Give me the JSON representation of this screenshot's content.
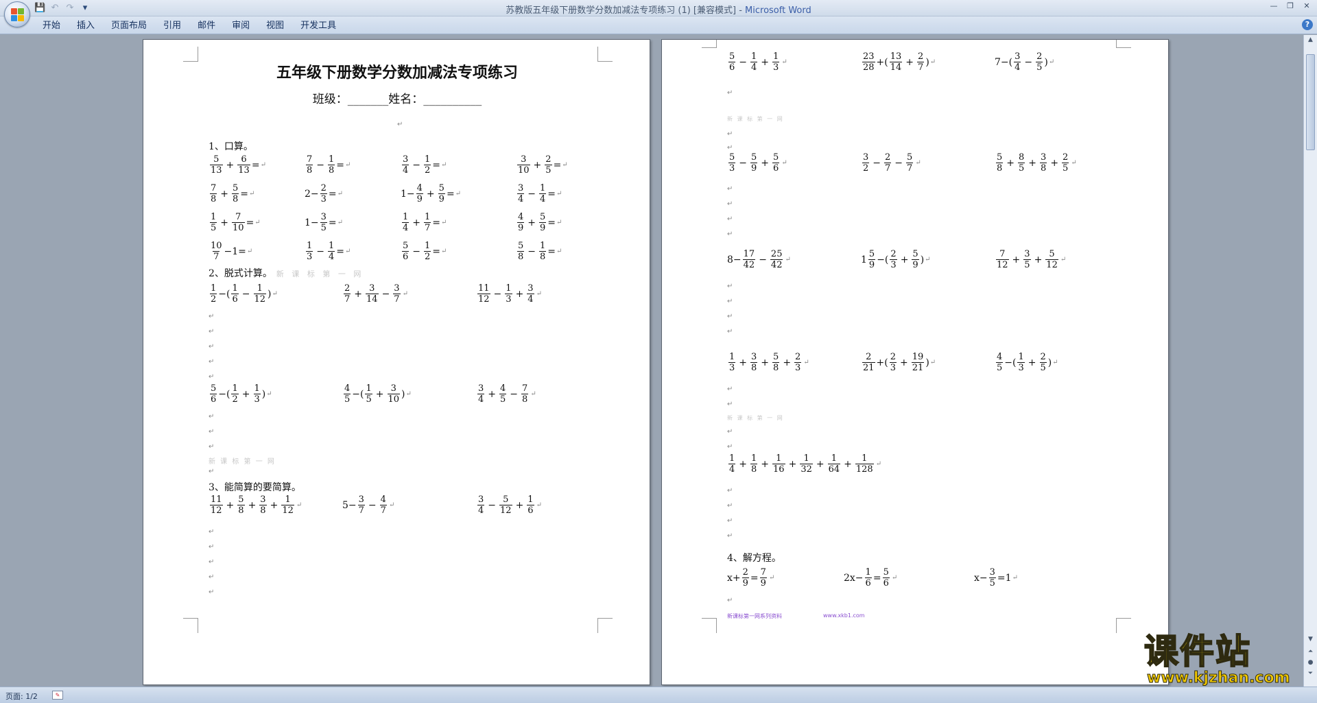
{
  "window": {
    "title": "苏教版五年级下册数学分数加减法专项练习 (1) [兼容模式] - ",
    "app_name": "Microsoft Word",
    "qat": [
      {
        "name": "save-icon",
        "glyph": "💾"
      },
      {
        "name": "undo-icon",
        "glyph": "↶"
      },
      {
        "name": "redo-icon",
        "glyph": "↷"
      },
      {
        "name": "customize-icon",
        "glyph": "▾"
      }
    ],
    "controls": [
      "—",
      "❐",
      "✕"
    ]
  },
  "ribbon": {
    "tabs": [
      "开始",
      "插入",
      "页面布局",
      "引用",
      "邮件",
      "审阅",
      "视图",
      "开发工具"
    ],
    "help_glyph": "?"
  },
  "page1": {
    "title": "五年级下册数学分数加减法专项练习",
    "subtitle": "班级：_______姓名：__________",
    "h1": "1、口算。",
    "h2": "2、脱式计算。",
    "h2_faint": "新 课 标 第 一 网",
    "faint_mid": "新 课 标 第 一 网",
    "h3": "3、能简算的要简算。",
    "oral": [
      [
        [
          {
            "f": [
              "5",
              "13"
            ]
          },
          {
            "o": "+"
          },
          {
            "f": [
              "6",
              "13"
            ]
          },
          {
            "t": "="
          }
        ],
        [
          {
            "f": [
              "7",
              "8"
            ]
          },
          {
            "o": "−"
          },
          {
            "f": [
              "1",
              "8"
            ]
          },
          {
            "t": "="
          }
        ],
        [
          {
            "f": [
              "3",
              "4"
            ]
          },
          {
            "o": "−"
          },
          {
            "f": [
              "1",
              "2"
            ]
          },
          {
            "t": "="
          }
        ],
        [
          {
            "f": [
              "3",
              "10"
            ]
          },
          {
            "o": "+"
          },
          {
            "f": [
              "2",
              "5"
            ]
          },
          {
            "t": "="
          }
        ]
      ],
      [
        [
          {
            "f": [
              "7",
              "8"
            ]
          },
          {
            "o": "+"
          },
          {
            "f": [
              "5",
              "8"
            ]
          },
          {
            "t": "="
          }
        ],
        [
          {
            "t": "2−"
          },
          {
            "f": [
              "2",
              "3"
            ]
          },
          {
            "t": "="
          }
        ],
        [
          {
            "t": "1−"
          },
          {
            "f": [
              "4",
              "9"
            ]
          },
          {
            "o": "+"
          },
          {
            "f": [
              "5",
              "9"
            ]
          },
          {
            "t": "="
          }
        ],
        [
          {
            "f": [
              "3",
              "4"
            ]
          },
          {
            "o": "−"
          },
          {
            "f": [
              "1",
              "4"
            ]
          },
          {
            "t": "="
          }
        ]
      ],
      [
        [
          {
            "f": [
              "1",
              "5"
            ]
          },
          {
            "o": "+"
          },
          {
            "f": [
              "7",
              "10"
            ]
          },
          {
            "t": "="
          }
        ],
        [
          {
            "t": "1−"
          },
          {
            "f": [
              "3",
              "5"
            ]
          },
          {
            "t": "="
          }
        ],
        [
          {
            "f": [
              "1",
              "4"
            ]
          },
          {
            "o": "+"
          },
          {
            "f": [
              "1",
              "7"
            ]
          },
          {
            "t": "="
          }
        ],
        [
          {
            "f": [
              "4",
              "9"
            ]
          },
          {
            "o": "+"
          },
          {
            "f": [
              "5",
              "9"
            ]
          },
          {
            "t": "="
          }
        ]
      ],
      [
        [
          {
            "f": [
              "10",
              "7"
            ]
          },
          {
            "t": "−1="
          }
        ],
        [
          {
            "f": [
              "1",
              "3"
            ]
          },
          {
            "o": "−"
          },
          {
            "f": [
              "1",
              "4"
            ]
          },
          {
            "t": "="
          }
        ],
        [
          {
            "f": [
              "5",
              "6"
            ]
          },
          {
            "o": "−"
          },
          {
            "f": [
              "1",
              "2"
            ]
          },
          {
            "t": "="
          }
        ],
        [
          {
            "f": [
              "5",
              "8"
            ]
          },
          {
            "o": "−"
          },
          {
            "f": [
              "1",
              "8"
            ]
          },
          {
            "t": "="
          }
        ]
      ]
    ],
    "calc_row1": [
      [
        {
          "f": [
            "1",
            "2"
          ]
        },
        {
          "t": "−("
        },
        {
          "f": [
            "1",
            "6"
          ]
        },
        {
          "o": "−"
        },
        {
          "f": [
            "1",
            "12"
          ]
        },
        {
          "t": ")"
        }
      ],
      [
        {
          "f": [
            "2",
            "7"
          ]
        },
        {
          "o": "+"
        },
        {
          "f": [
            "3",
            "14"
          ]
        },
        {
          "o": "−"
        },
        {
          "f": [
            "3",
            "7"
          ]
        }
      ],
      [
        {
          "f": [
            "11",
            "12"
          ]
        },
        {
          "o": "−"
        },
        {
          "f": [
            "1",
            "3"
          ]
        },
        {
          "o": "+"
        },
        {
          "f": [
            "3",
            "4"
          ]
        }
      ]
    ],
    "calc_row2": [
      [
        {
          "f": [
            "5",
            "6"
          ]
        },
        {
          "t": "−("
        },
        {
          "f": [
            "1",
            "2"
          ]
        },
        {
          "o": "+"
        },
        {
          "f": [
            "1",
            "3"
          ]
        },
        {
          "t": ")"
        }
      ],
      [
        {
          "f": [
            "4",
            "5"
          ]
        },
        {
          "t": "−("
        },
        {
          "f": [
            "1",
            "5"
          ]
        },
        {
          "o": "+"
        },
        {
          "f": [
            "3",
            "10"
          ]
        },
        {
          "t": ")"
        }
      ],
      [
        {
          "f": [
            "3",
            "4"
          ]
        },
        {
          "o": "+"
        },
        {
          "f": [
            "4",
            "5"
          ]
        },
        {
          "o": "−"
        },
        {
          "f": [
            "7",
            "8"
          ]
        }
      ]
    ],
    "simp_row": [
      [
        {
          "f": [
            "11",
            "12"
          ]
        },
        {
          "o": "+"
        },
        {
          "f": [
            "5",
            "8"
          ]
        },
        {
          "o": "+"
        },
        {
          "f": [
            "3",
            "8"
          ]
        },
        {
          "o": "+"
        },
        {
          "f": [
            "1",
            "12"
          ]
        }
      ],
      [
        {
          "t": "5−"
        },
        {
          "f": [
            "3",
            "7"
          ]
        },
        {
          "o": "−"
        },
        {
          "f": [
            "4",
            "7"
          ]
        }
      ],
      [
        {
          "f": [
            "3",
            "4"
          ]
        },
        {
          "o": "−"
        },
        {
          "f": [
            "5",
            "12"
          ]
        },
        {
          "o": "+"
        },
        {
          "f": [
            "1",
            "6"
          ]
        }
      ]
    ]
  },
  "page2": {
    "faint1": "新 课 标 第 一 网",
    "faint2": "新 课 标 第 一 网",
    "h4": "4、解方程。",
    "purple1": "新课标第一网系列资料",
    "purple2": "www.xkb1.com",
    "row1": [
      [
        {
          "f": [
            "5",
            "6"
          ]
        },
        {
          "o": "−"
        },
        {
          "f": [
            "1",
            "4"
          ]
        },
        {
          "o": "+"
        },
        {
          "f": [
            "1",
            "3"
          ]
        }
      ],
      [
        {
          "f": [
            "23",
            "28"
          ]
        },
        {
          "t": "+("
        },
        {
          "f": [
            "13",
            "14"
          ]
        },
        {
          "o": "+"
        },
        {
          "f": [
            "2",
            "7"
          ]
        },
        {
          "t": ")"
        }
      ],
      [
        {
          "t": "7−("
        },
        {
          "f": [
            "3",
            "4"
          ]
        },
        {
          "o": "−"
        },
        {
          "f": [
            "2",
            "5"
          ]
        },
        {
          "t": ")"
        }
      ]
    ],
    "row2": [
      [
        {
          "f": [
            "5",
            "3"
          ]
        },
        {
          "o": "−"
        },
        {
          "f": [
            "5",
            "9"
          ]
        },
        {
          "o": "+"
        },
        {
          "f": [
            "5",
            "6"
          ]
        }
      ],
      [
        {
          "f": [
            "3",
            "2"
          ]
        },
        {
          "o": "−"
        },
        {
          "f": [
            "2",
            "7"
          ]
        },
        {
          "o": "−"
        },
        {
          "f": [
            "5",
            "7"
          ]
        }
      ],
      [
        {
          "f": [
            "5",
            "8"
          ]
        },
        {
          "o": "+"
        },
        {
          "f": [
            "8",
            "5"
          ]
        },
        {
          "o": "+"
        },
        {
          "f": [
            "3",
            "8"
          ]
        },
        {
          "o": "+"
        },
        {
          "f": [
            "2",
            "5"
          ]
        }
      ]
    ],
    "row3": [
      [
        {
          "t": "8−"
        },
        {
          "f": [
            "17",
            "42"
          ]
        },
        {
          "o": "−"
        },
        {
          "f": [
            "25",
            "42"
          ]
        }
      ],
      [
        {
          "t": "1"
        },
        {
          "f": [
            "5",
            "9"
          ]
        },
        {
          "t": "−("
        },
        {
          "f": [
            "2",
            "3"
          ]
        },
        {
          "o": "+"
        },
        {
          "f": [
            "5",
            "9"
          ]
        },
        {
          "t": ")"
        }
      ],
      [
        {
          "f": [
            "7",
            "12"
          ]
        },
        {
          "o": "+"
        },
        {
          "f": [
            "3",
            "5"
          ]
        },
        {
          "o": "+"
        },
        {
          "f": [
            "5",
            "12"
          ]
        }
      ]
    ],
    "row4": [
      [
        {
          "f": [
            "1",
            "3"
          ]
        },
        {
          "o": "+"
        },
        {
          "f": [
            "3",
            "8"
          ]
        },
        {
          "o": "+"
        },
        {
          "f": [
            "5",
            "8"
          ]
        },
        {
          "o": "+"
        },
        {
          "f": [
            "2",
            "3"
          ]
        }
      ],
      [
        {
          "f": [
            "2",
            "21"
          ]
        },
        {
          "t": "+("
        },
        {
          "f": [
            "2",
            "3"
          ]
        },
        {
          "o": "+"
        },
        {
          "f": [
            "19",
            "21"
          ]
        },
        {
          "t": ")"
        }
      ],
      [
        {
          "f": [
            "4",
            "5"
          ]
        },
        {
          "t": "−("
        },
        {
          "f": [
            "1",
            "3"
          ]
        },
        {
          "o": "+"
        },
        {
          "f": [
            "2",
            "5"
          ]
        },
        {
          "t": ")"
        }
      ]
    ],
    "row5": [
      [
        {
          "f": [
            "1",
            "4"
          ]
        },
        {
          "o": "+"
        },
        {
          "f": [
            "1",
            "8"
          ]
        },
        {
          "o": "+"
        },
        {
          "f": [
            "1",
            "16"
          ]
        },
        {
          "o": "+"
        },
        {
          "f": [
            "1",
            "32"
          ]
        },
        {
          "o": "+"
        },
        {
          "f": [
            "1",
            "64"
          ]
        },
        {
          "o": "+"
        },
        {
          "f": [
            "1",
            "128"
          ]
        }
      ]
    ],
    "eq_row": [
      [
        {
          "t": "x+"
        },
        {
          "f": [
            "2",
            "9"
          ]
        },
        {
          "t": "="
        },
        {
          "f": [
            "7",
            "9"
          ]
        }
      ],
      [
        {
          "t": "2x−"
        },
        {
          "f": [
            "1",
            "6"
          ]
        },
        {
          "t": "="
        },
        {
          "f": [
            "5",
            "6"
          ]
        }
      ],
      [
        {
          "t": "x−"
        },
        {
          "f": [
            "3",
            "5"
          ]
        },
        {
          "t": "=1"
        }
      ]
    ]
  },
  "status": {
    "page": "页面: 1/2"
  },
  "watermark": {
    "cn": "课件站",
    "url": "www.kjzhan.com"
  }
}
